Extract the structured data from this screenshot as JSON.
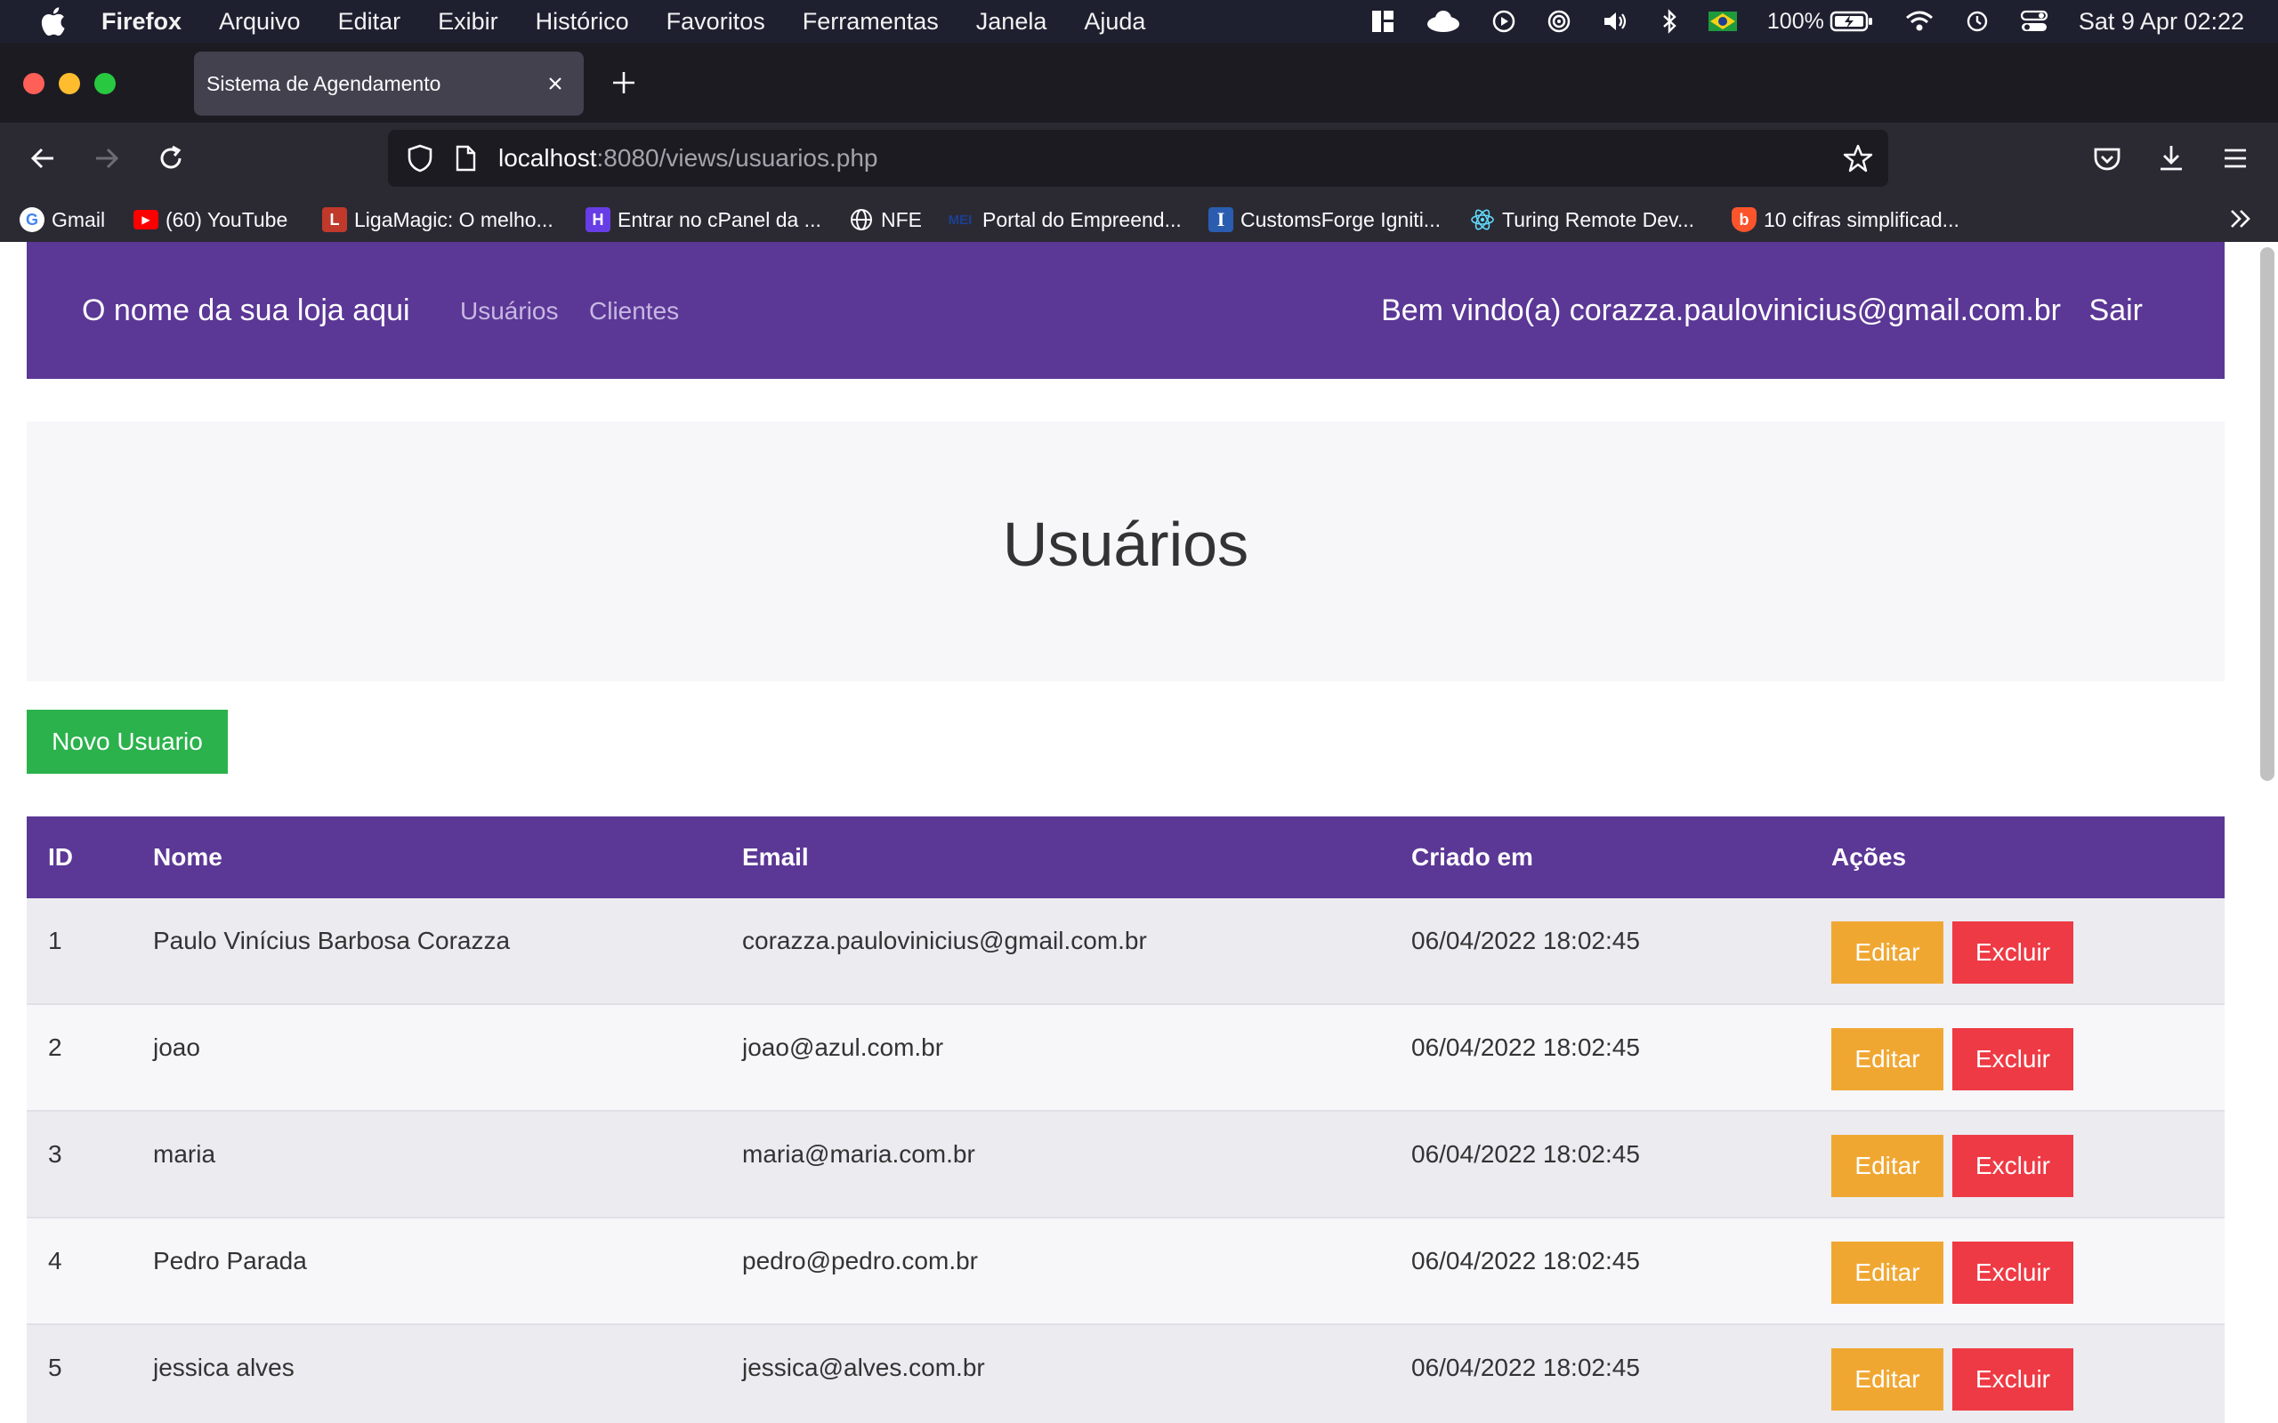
{
  "menubar": {
    "app": "Firefox",
    "items": [
      "Arquivo",
      "Editar",
      "Exibir",
      "Histórico",
      "Favoritos",
      "Ferramentas",
      "Janela",
      "Ajuda"
    ],
    "battery": "100%",
    "clock": "Sat 9 Apr  02:22"
  },
  "browser": {
    "tab_title": "Sistema de Agendamento",
    "url_host": "localhost",
    "url_rest": ":8080/views/usuarios.php",
    "bookmarks": [
      {
        "label": "Gmail",
        "icon": "google-icon"
      },
      {
        "label": "(60) YouTube",
        "icon": "youtube-icon"
      },
      {
        "label": "LigaMagic: O melho...",
        "icon": "ligamagic-icon"
      },
      {
        "label": "Entrar no cPanel da ...",
        "icon": "hostinger-icon"
      },
      {
        "label": "NFE",
        "icon": "globe-icon"
      },
      {
        "label": "Portal do Empreend...",
        "icon": "mei-icon"
      },
      {
        "label": "CustomsForge Igniti...",
        "icon": "customsforge-icon"
      },
      {
        "label": "Turing Remote Dev...",
        "icon": "react-icon"
      },
      {
        "label": "10 cifras simplificad...",
        "icon": "brave-icon"
      }
    ]
  },
  "site": {
    "brand": "O nome da sua loja aqui",
    "nav": [
      "Usuários",
      "Clientes"
    ],
    "welcome": "Bem vindo(a) corazza.paulovinicius@gmail.com.br",
    "logout": "Sair",
    "page_title": "Usuários",
    "new_button": "Novo Usuario",
    "table": {
      "headers": [
        "ID",
        "Nome",
        "Email",
        "Criado em",
        "Ações"
      ],
      "edit_label": "Editar",
      "delete_label": "Excluir",
      "rows": [
        {
          "id": "1",
          "name": "Paulo Vinícius Barbosa Corazza",
          "email": "corazza.paulovinicius@gmail.com.br",
          "created": "06/04/2022 18:02:45"
        },
        {
          "id": "2",
          "name": "joao",
          "email": "joao@azul.com.br",
          "created": "06/04/2022 18:02:45"
        },
        {
          "id": "3",
          "name": "maria",
          "email": "maria@maria.com.br",
          "created": "06/04/2022 18:02:45"
        },
        {
          "id": "4",
          "name": "Pedro Parada",
          "email": "pedro@pedro.com.br",
          "created": "06/04/2022 18:02:45"
        },
        {
          "id": "5",
          "name": "jessica alves",
          "email": "jessica@alves.com.br",
          "created": "06/04/2022 18:02:45"
        }
      ]
    }
  },
  "colors": {
    "brand_purple": "#5b3796",
    "success": "#2bb24c",
    "warning": "#f0a732",
    "danger": "#ee3a44"
  }
}
